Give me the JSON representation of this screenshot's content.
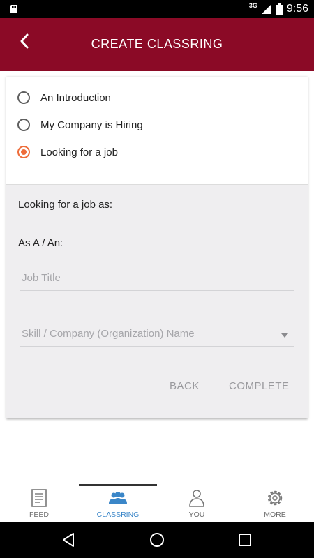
{
  "status_bar": {
    "network": "3G",
    "time": "9:56"
  },
  "app_bar": {
    "title": "CREATE CLASSRING"
  },
  "options": [
    {
      "label": "An Introduction",
      "selected": false
    },
    {
      "label": "My Company is Hiring",
      "selected": false
    },
    {
      "label": "Looking for a job",
      "selected": true
    }
  ],
  "form": {
    "section_label": "Looking for a job as:",
    "as_label": "As A / An:",
    "job_title_placeholder": "Job Title",
    "skill_placeholder": "Skill / Company (Organization) Name",
    "back_label": "BACK",
    "complete_label": "COMPLETE"
  },
  "bottom_nav": {
    "items": [
      {
        "label": "FEED",
        "icon": "feed-icon",
        "active": false
      },
      {
        "label": "CLASSRING",
        "icon": "group-icon",
        "active": true
      },
      {
        "label": "YOU",
        "icon": "person-icon",
        "active": false
      },
      {
        "label": "MORE",
        "icon": "gear-icon",
        "active": false
      }
    ]
  },
  "colors": {
    "app_bar": "#8b0a26",
    "accent": "#ee6d3b",
    "nav_active": "#3a86c8"
  }
}
